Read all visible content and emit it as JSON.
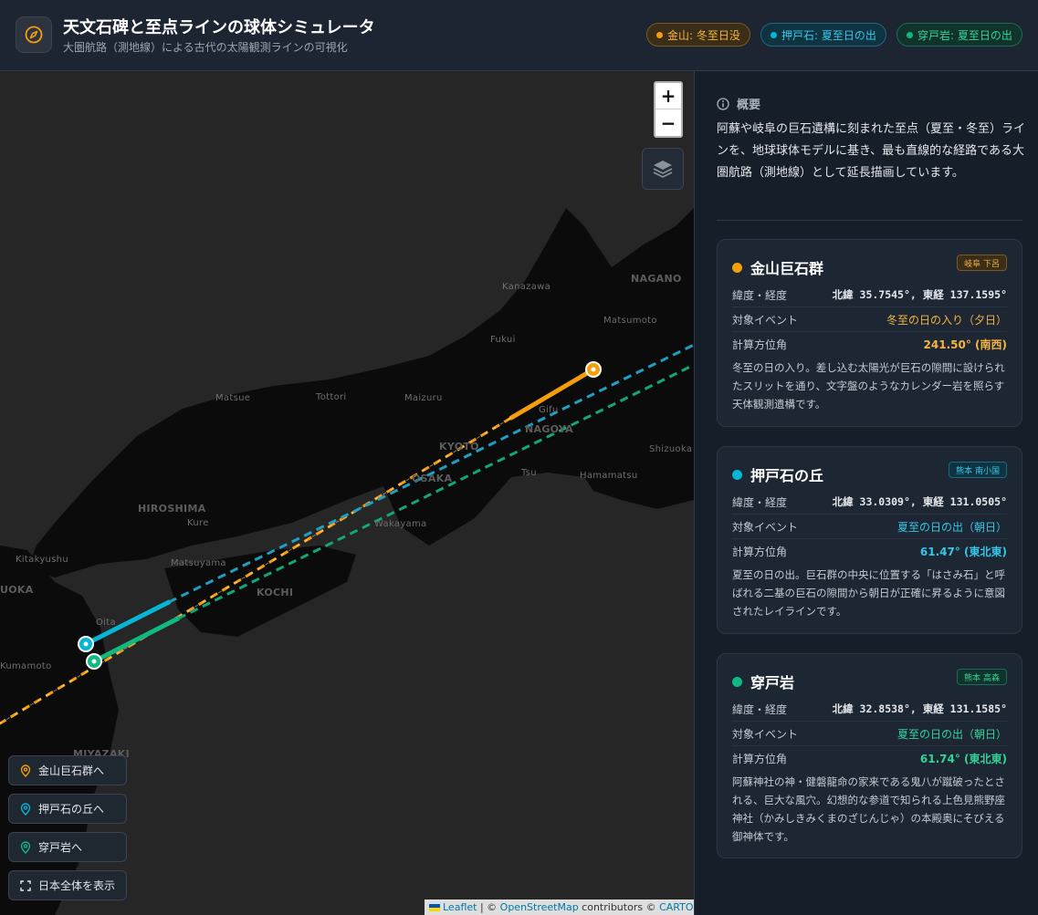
{
  "header": {
    "title": "天文石碑と至点ラインの球体シミュレータ",
    "subtitle": "大圏航路（測地線）による古代の太陽観測ラインの可視化",
    "badges": [
      {
        "label": "金山: 冬至日没",
        "color": "#f59e0b"
      },
      {
        "label": "押戸石: 夏至日の出",
        "color": "#06b6d4"
      },
      {
        "label": "穿戸岩: 夏至日の出",
        "color": "#10b981"
      }
    ]
  },
  "map": {
    "labels": {
      "nagano": "NAGANO",
      "kanazawa": "Kanazawa",
      "matsumoto": "Matsumoto",
      "fukui": "Fukui",
      "tottori": "Tottori",
      "maizuru": "Maizuru",
      "matsue": "Matsue",
      "gifu": "Gifu",
      "nagoya": "NAGOYA",
      "kyoto": "KYOTO",
      "osaka": "OSAKA",
      "tsu": "Tsu",
      "shizuoka": "Shizuoka",
      "hamamatsu": "Hamamatsu",
      "hiroshima": "HIROSHIMA",
      "kure": "Kure",
      "wakayama": "Wakayama",
      "kitakyushu": "Kitakyushu",
      "matsuyama": "Matsuyama",
      "kochi": "KOCHI",
      "fukuoka": "UOKA",
      "kumamoto": "Kumamoto",
      "oita": "Oita",
      "miyazaki": "MIYAZAKI"
    },
    "zoom_in": "+",
    "zoom_out": "−",
    "layers_icon": "layers-icon",
    "nav_buttons": [
      {
        "label": "金山巨石群へ",
        "icon": "map-pin-icon",
        "color": "#f59e0b"
      },
      {
        "label": "押戸石の丘へ",
        "icon": "map-pin-icon",
        "color": "#06b6d4"
      },
      {
        "label": "穿戸岩へ",
        "icon": "map-pin-icon",
        "color": "#10b981"
      },
      {
        "label": "日本全体を表示",
        "icon": "fullscreen-icon",
        "color": "#e5e7eb"
      }
    ],
    "attribution": {
      "leaflet": "Leaflet",
      "sep1": " | © ",
      "osm": "OpenStreetMap",
      "contrib": " contributors © ",
      "carto": "CARTO"
    }
  },
  "panel": {
    "overview_title": "概要",
    "overview_text": "阿蘇や岐阜の巨石遺構に刻まれた至点（夏至・冬至）ラインを、地球球体モデルに基き、最も直線的な経路である大圏航路（測地線）として延長描画しています。",
    "cards": [
      {
        "name": "金山巨石群",
        "tag": "岐阜 下呂",
        "color": "#f59e0b",
        "coord_label": "緯度・経度",
        "coord_value": "北緯 35.7545°, 東経 137.1595°",
        "event_label": "対象イベント",
        "event_value": "冬至の日の入り（夕日）",
        "azimuth_label": "計算方位角",
        "azimuth_value": "241.50° (南西)",
        "description": "冬至の日の入り。差し込む太陽光が巨石の隙間に設けられたスリットを通り、文字盤のようなカレンダー岩を照らす天体観測遺構です。"
      },
      {
        "name": "押戸石の丘",
        "tag": "熊本 南小国",
        "color": "#06b6d4",
        "coord_label": "緯度・経度",
        "coord_value": "北緯 33.0309°, 東経 131.0505°",
        "event_label": "対象イベント",
        "event_value": "夏至の日の出（朝日）",
        "azimuth_label": "計算方位角",
        "azimuth_value": "61.47° (東北東)",
        "description": "夏至の日の出。巨石群の中央に位置する「はさみ石」と呼ばれる二基の巨石の隙間から朝日が正確に昇るように意図されたレイラインです。"
      },
      {
        "name": "穿戸岩",
        "tag": "熊本 高森",
        "color": "#10b981",
        "coord_label": "緯度・経度",
        "coord_value": "北緯 32.8538°, 東経 131.1585°",
        "event_label": "対象イベント",
        "event_value": "夏至の日の出（朝日）",
        "azimuth_label": "計算方位角",
        "azimuth_value": "61.74° (東北東)",
        "description": "阿蘇神社の神・健磐龍命の家来である鬼八が蹴破ったとされる、巨大な風穴。幻想的な参道で知られる上色見熊野座神社（かみしきみくまのざじんじゃ）の本殿奥にそびえる御神体です。"
      }
    ]
  }
}
